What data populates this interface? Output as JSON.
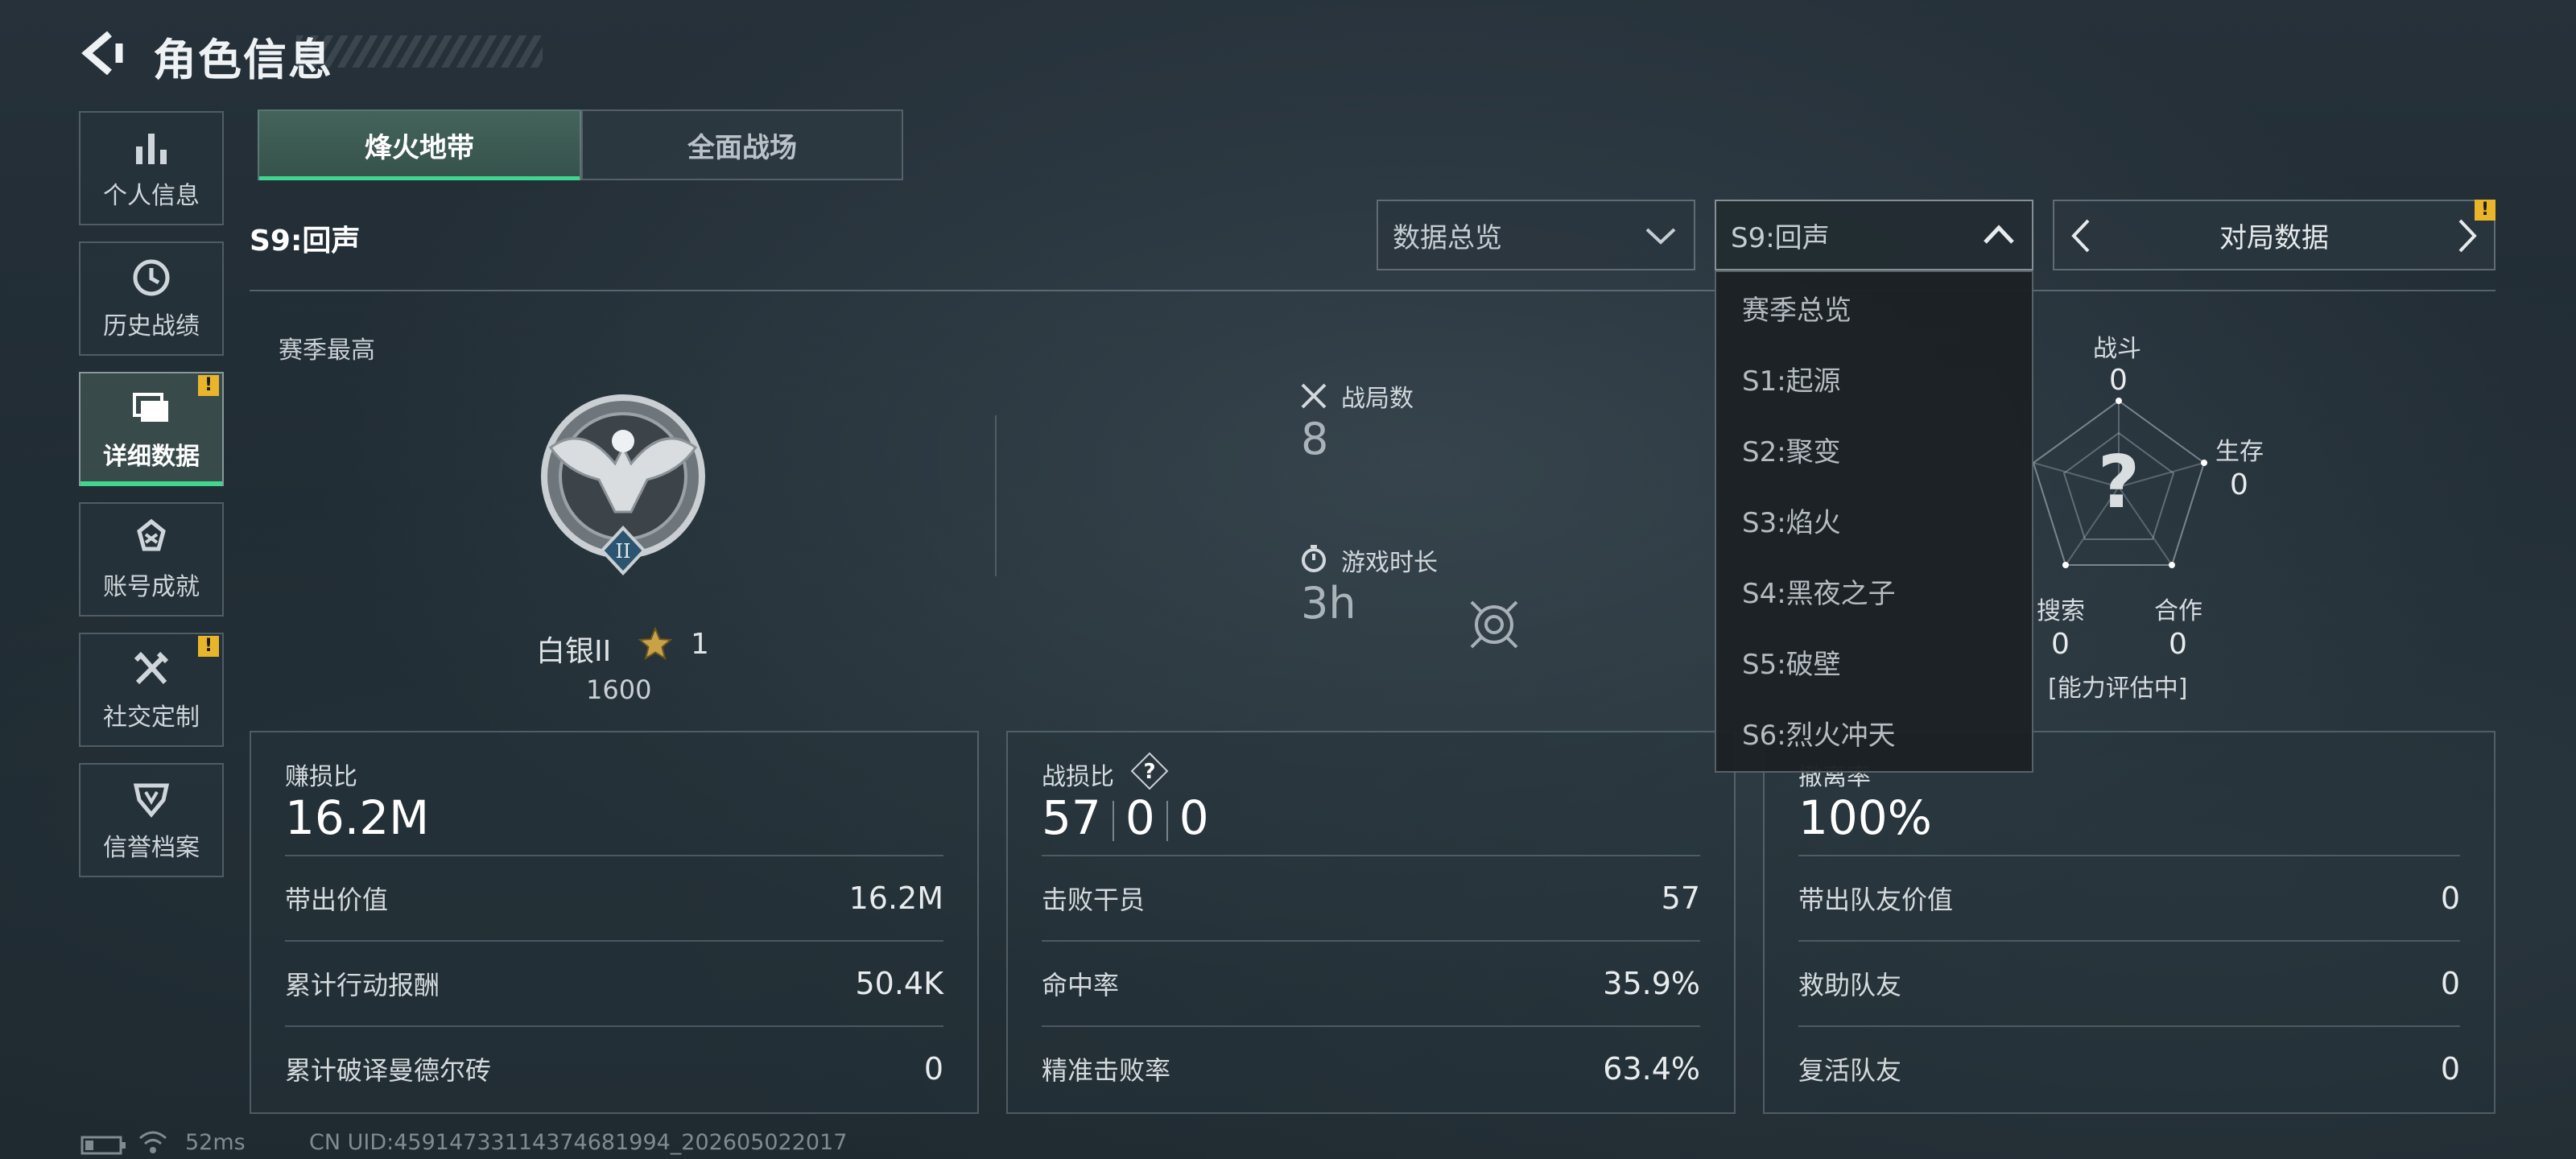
{
  "header": {
    "title": "角色信息"
  },
  "sidebar": {
    "items": [
      {
        "label": "个人信息",
        "icon": "bar-chart-icon",
        "active": false,
        "badge": ""
      },
      {
        "label": "历史战绩",
        "icon": "history-clock-icon",
        "active": false,
        "badge": ""
      },
      {
        "label": "详细数据",
        "icon": "folders-icon",
        "active": true,
        "badge": "!"
      },
      {
        "label": "账号成就",
        "icon": "achievement-icon",
        "active": false,
        "badge": ""
      },
      {
        "label": "社交定制",
        "icon": "tools-icon",
        "active": false,
        "badge": "!"
      },
      {
        "label": "信誉档案",
        "icon": "reputation-icon",
        "active": false,
        "badge": ""
      }
    ]
  },
  "tabs": [
    {
      "label": "烽火地带",
      "active": true
    },
    {
      "label": "全面战场",
      "active": false
    }
  ],
  "season": {
    "title": "S9:回声"
  },
  "filters": {
    "type_select": "数据总览",
    "season_select": "S9:回声",
    "match_data": "对局数据",
    "match_data_badge": "!"
  },
  "season_menu": {
    "options": [
      "赛季总览",
      "S1:起源",
      "S2:聚变",
      "S3:焰火",
      "S4:黑夜之子",
      "S5:破壁",
      "S6:烈火冲天"
    ]
  },
  "season_best": {
    "label": "赛季最高",
    "rank": "白银II",
    "stars": "1",
    "score": "1600",
    "badge_numeral": "II"
  },
  "stats": {
    "matches_label": "战局数",
    "matches_value": "8",
    "playtime_label": "游戏时长",
    "playtime_value": "3h"
  },
  "radar": {
    "fight_label": "战斗",
    "fight_value": "0",
    "survive_label": "生存",
    "survive_value": "0",
    "search_label": "搜索",
    "search_value": "0",
    "coop_label": "合作",
    "coop_value": "0",
    "center": "?",
    "status": "[能力评估中]"
  },
  "cards": {
    "profit": {
      "title": "赚损比",
      "value": "16.2M",
      "rows": [
        {
          "label": "带出价值",
          "value": "16.2M"
        },
        {
          "label": "累计行动报酬",
          "value": "50.4K"
        },
        {
          "label": "累计破译曼德尔砖",
          "value": "0"
        }
      ]
    },
    "combat": {
      "title": "战损比",
      "help": "?",
      "kills": "57",
      "deaths": "0",
      "assists": "0",
      "rows": [
        {
          "label": "击败干员",
          "value": "57"
        },
        {
          "label": "命中率",
          "value": "35.9%"
        },
        {
          "label": "精准击败率",
          "value": "63.4%"
        }
      ]
    },
    "team": {
      "title": "撤离率",
      "value": "100%",
      "rows": [
        {
          "label": "带出队友价值",
          "value": "0"
        },
        {
          "label": "救助队友",
          "value": "0"
        },
        {
          "label": "复活队友",
          "value": "0"
        }
      ]
    }
  },
  "footer": {
    "ping": "52ms",
    "uid": "CN UID:4591473311437468199­4_202605022017"
  },
  "colors": {
    "accent": "#3fd68f",
    "warning": "#e8b52b"
  }
}
